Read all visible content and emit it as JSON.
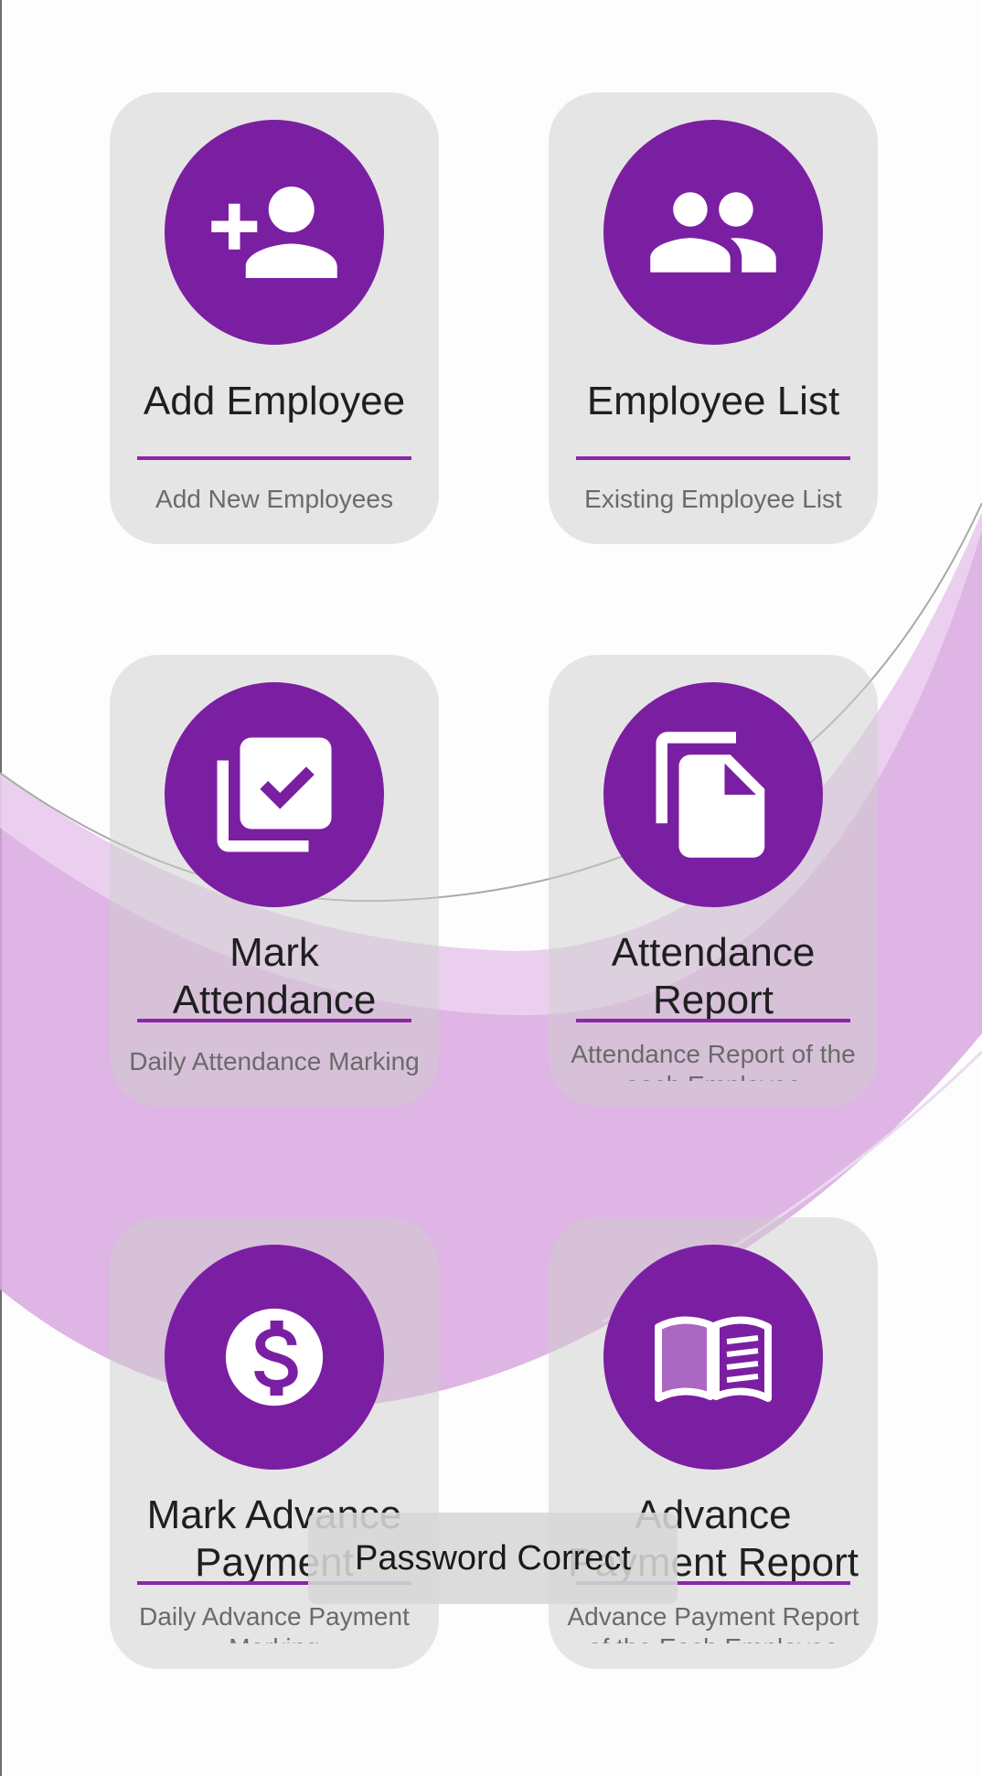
{
  "cards": [
    {
      "title": "Add Employee",
      "description": "Add New Employees",
      "icon": "person-add-icon"
    },
    {
      "title": "Employee List",
      "description": "Existing Employee List",
      "icon": "people-icon"
    },
    {
      "title": "Mark\nAttendance",
      "description": "Daily Attendance Marking",
      "icon": "library-check-icon"
    },
    {
      "title": "Attendance\nReport",
      "description": "Attendance Report of the\neach Employee",
      "icon": "copy-document-icon"
    },
    {
      "title": "Mark Advance\nPayment",
      "description": "Daily Advance Payment\nMarking",
      "icon": "dollar-circle-icon"
    },
    {
      "title": "Advance\nPayment Report",
      "description": "Advance Payment Report\nof the Each Employee",
      "icon": "open-book-icon"
    }
  ],
  "toast": {
    "message": "Password Correct"
  },
  "colors": {
    "accent": "#7b1fa2",
    "divider": "#8e24aa",
    "card_background": "#e4e4e4",
    "wave": "#d9a8e0"
  }
}
